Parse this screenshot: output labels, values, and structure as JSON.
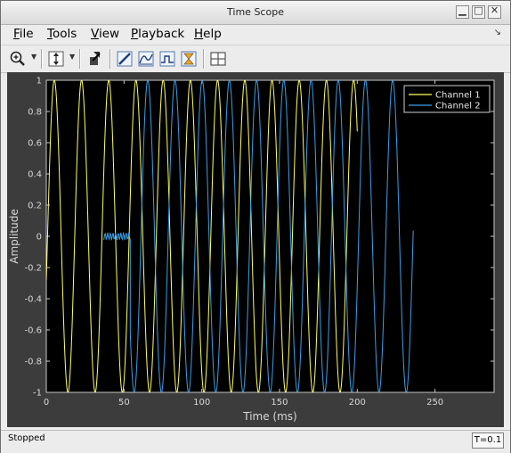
{
  "window": {
    "title": "Time Scope",
    "controls": {
      "minimize_icon": "minimize-icon",
      "maximize_icon": "maximize-icon",
      "close_icon": "close-icon"
    }
  },
  "menubar": {
    "items": [
      {
        "label": "File",
        "accel": "F"
      },
      {
        "label": "Tools",
        "accel": "T"
      },
      {
        "label": "View",
        "accel": "V"
      },
      {
        "label": "Playback",
        "accel": "P"
      },
      {
        "label": "Help",
        "accel": "H"
      }
    ],
    "dock_icon": "dock-arrow-icon"
  },
  "toolbar": {
    "buttons": [
      {
        "name": "zoom-in-button",
        "icon": "zoom-in-icon",
        "dropdown": true
      },
      {
        "name": "scale-axes-button",
        "icon": "scale-axes-icon",
        "dropdown": true
      },
      {
        "name": "simulink-highlight-button",
        "icon": "highlight-icon",
        "dropdown": false
      },
      {
        "name": "triggers-button",
        "icon": "triggers-icon",
        "dropdown": false
      },
      {
        "name": "peak-finder-button",
        "icon": "peak-finder-icon",
        "dropdown": false
      },
      {
        "name": "data-cursors-button",
        "icon": "data-cursors-icon",
        "dropdown": false
      },
      {
        "name": "cursor-measurements-button",
        "icon": "cursor-measurements-icon",
        "dropdown": false
      },
      {
        "name": "layout-button",
        "icon": "layout-grid-icon",
        "dropdown": false
      }
    ]
  },
  "colors": {
    "plot_background": "#000000",
    "axes_color": "#c8c8c8",
    "channel1": "#ffff66",
    "channel2": "#3d9ee6",
    "scope_background": "#3c3c3c"
  },
  "chart_data": {
    "type": "line",
    "title": "",
    "xlabel": "Time (ms)",
    "ylabel": "Amplitude",
    "xlim": [
      0,
      288
    ],
    "ylim": [
      -1,
      1
    ],
    "xticks": [
      0,
      50,
      100,
      150,
      200,
      250
    ],
    "xtick_labels": [
      "0",
      "50",
      "100",
      "150",
      "200",
      "250"
    ],
    "yticks": [
      1,
      0.8,
      0.6,
      0.4,
      0.2,
      0,
      -0.2,
      -0.4,
      -0.6,
      -0.8,
      -1
    ],
    "ytick_labels": [
      "1",
      "0.8",
      "0.6",
      "0.4",
      "0.2",
      "0",
      "-0.2",
      "-0.4",
      "-0.6",
      "-0.8",
      "-1"
    ],
    "grid": false,
    "legend_position": "top-right",
    "series": [
      {
        "name": "Channel 1",
        "color": "#ffff66",
        "x_start": 0,
        "x_end": 200,
        "period_ms": 17.5,
        "amplitude": 1,
        "phase_ms": 0.8
      },
      {
        "name": "Channel 2",
        "color": "#3d9ee6",
        "flat_segment": {
          "x_start": 37,
          "x_end": 54,
          "y": 0
        },
        "x_start": 54,
        "x_end": 236,
        "period_ms": 17.5,
        "amplitude": 1,
        "phase_ms": 8.4
      }
    ]
  },
  "status": {
    "text": "Stopped",
    "time_label": "T=0.1"
  }
}
